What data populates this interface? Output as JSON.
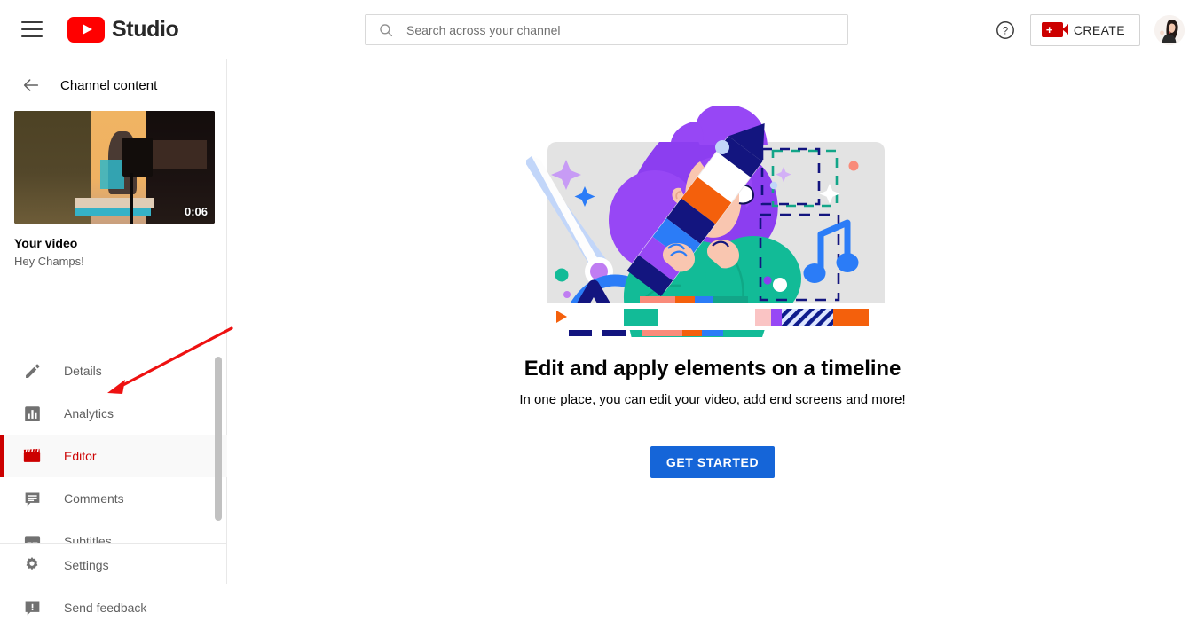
{
  "header": {
    "menu_icon": "hamburger-menu-icon",
    "brand": "Studio",
    "logo_icon": "youtube-logo-icon",
    "search": {
      "icon": "search-icon",
      "placeholder": "Search across your channel",
      "value": ""
    },
    "help_icon": "help-circle-icon",
    "create": {
      "icon": "video-camera-plus-icon",
      "label": "CREATE"
    },
    "avatar": "user-avatar"
  },
  "sidebar": {
    "back_icon": "back-arrow-icon",
    "back_label": "Channel content",
    "video": {
      "thumbnail": "video-thumbnail",
      "duration": "0:06",
      "title": "Your video",
      "subtitle": "Hey Champs!"
    },
    "items": [
      {
        "icon": "pencil-icon",
        "label": "Details",
        "active": false
      },
      {
        "icon": "bar-chart-icon",
        "label": "Analytics",
        "active": false
      },
      {
        "icon": "clapperboard-icon",
        "label": "Editor",
        "active": true
      },
      {
        "icon": "comment-icon",
        "label": "Comments",
        "active": false
      },
      {
        "icon": "subtitles-icon",
        "label": "Subtitles",
        "active": false
      }
    ],
    "bottom_items": [
      {
        "icon": "gear-icon",
        "label": "Settings"
      },
      {
        "icon": "feedback-icon",
        "label": "Send feedback"
      }
    ]
  },
  "main": {
    "illustration": "video-editor-illustration",
    "headline": "Edit and apply elements on a timeline",
    "subline": "In one place, you can edit your video, add end screens and more!",
    "cta_label": "GET STARTED"
  },
  "annotation": {
    "arrow": "red-pointer-arrow",
    "color": "#ee1111"
  },
  "colors": {
    "brand_red": "#ff0000",
    "active_red": "#cc0000",
    "cta_blue": "#1565d8",
    "text_primary": "#030303",
    "text_secondary": "#606060"
  }
}
